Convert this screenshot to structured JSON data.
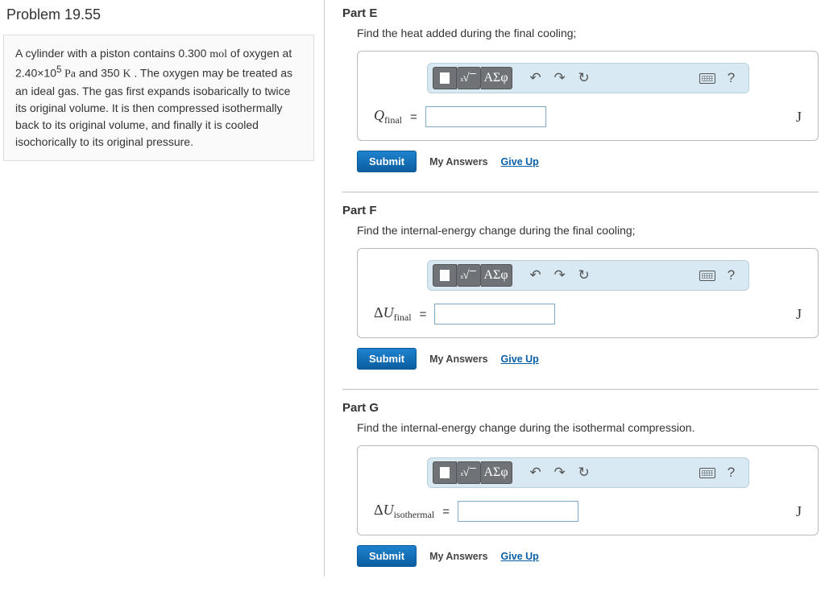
{
  "problem": {
    "title": "Problem 19.55",
    "text_1": "A cylinder with a piston contains 0.300 ",
    "mol": "mol",
    "text_2": " of oxygen at 2.40×10",
    "exp": "5",
    "pa": " Pa",
    "text_3": " and 350 ",
    "kelvin": "K",
    "text_4": " . The oxygen may be treated as an ideal gas. The gas first expands isobarically to twice its original volume. It is then compressed isothermally back to its original volume, and finally it is cooled isochorically to its original pressure."
  },
  "toolbar": {
    "greek": "ΑΣφ",
    "help": "?"
  },
  "controls": {
    "submit": "Submit",
    "my_answers": "My Answers",
    "give_up": "Give Up"
  },
  "parts": {
    "E": {
      "header": "Part E",
      "prompt": "Find the heat added during the final cooling;",
      "var": "Q",
      "sub": "final",
      "unit": "J"
    },
    "F": {
      "header": "Part F",
      "prompt": "Find the internal-energy change during the final cooling;",
      "var": "ΔU",
      "sub": "final",
      "unit": "J"
    },
    "G": {
      "header": "Part G",
      "prompt": "Find the internal-energy change during the isothermal compression.",
      "var": "ΔU",
      "sub": "isothermal",
      "unit": "J"
    }
  }
}
